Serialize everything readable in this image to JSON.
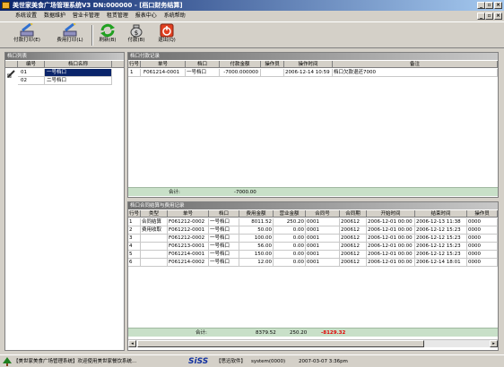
{
  "window": {
    "title": "美世家美食广场管理系统V3 DN:000000 - [档口财务结算]"
  },
  "menu": [
    "系统设置",
    "数据维护",
    "营业卡管理",
    "租赁管理",
    "报表中心",
    "系统帮助"
  ],
  "toolbar": [
    {
      "label": "付款打印(E)",
      "icon": "pen-print-icon"
    },
    {
      "label": "费用打印(L)",
      "icon": "pen-print-icon"
    },
    {
      "label": "刷新(B)",
      "icon": "refresh-icon"
    },
    {
      "label": "付款(B)",
      "icon": "money-bag-icon"
    },
    {
      "label": "退出(Q)",
      "icon": "exit-icon"
    }
  ],
  "stall_panel": {
    "title": "档口列表",
    "headers": [
      "编号",
      "档口名称"
    ],
    "rows": [
      [
        "01",
        "一号档口"
      ],
      [
        "02",
        "二号档口"
      ]
    ]
  },
  "payment_panel": {
    "title": "档口付款记录",
    "headers": [
      "行号",
      "单号",
      "档口",
      "付款金额",
      "操作员",
      "操作时间",
      "备注"
    ],
    "rows": [
      [
        "1",
        "F061214-0001",
        "一号档口",
        "-7000.000000",
        "",
        "2006-12-14  10:59",
        "档口欠款退还7000"
      ]
    ],
    "total_label": "合计:",
    "total_amount": "-7000.00"
  },
  "contract_panel": {
    "title": "档口合同结算与费用记录",
    "headers": [
      "行号",
      "类型",
      "单号",
      "档口",
      "费用金额",
      "营业金额",
      "合同号",
      "合同期",
      "开始时间",
      "结束时间",
      "操作员"
    ],
    "rows": [
      [
        "1",
        "合同结算",
        "F061212-0002",
        "一号档口",
        "8011.52",
        "250.20",
        "0001",
        "200612",
        "2006-12-01  00:00",
        "2006-12-13  11:38",
        "0000"
      ],
      [
        "2",
        "费用收取",
        "F061212-0001",
        "一号档口",
        "50.00",
        "0.00",
        "0001",
        "200612",
        "2006-12-01  00:00",
        "2006-12-12  15:23",
        "0000"
      ],
      [
        "3",
        "",
        "F061212-0002",
        "一号档口",
        "100.00",
        "0.00",
        "0001",
        "200612",
        "2006-12-01  00:00",
        "2006-12-12  15:23",
        "0000"
      ],
      [
        "4",
        "",
        "F061213-0001",
        "一号档口",
        "56.00",
        "0.00",
        "0001",
        "200612",
        "2006-12-01  00:00",
        "2006-12-12  15:23",
        "0000"
      ],
      [
        "5",
        "",
        "F061214-0001",
        "一号档口",
        "150.00",
        "0.00",
        "0001",
        "200612",
        "2006-12-01  00:00",
        "2006-12-12  15:23",
        "0000"
      ],
      [
        "6",
        "",
        "F061214-0002",
        "一号档口",
        "12.00",
        "0.00",
        "0001",
        "200612",
        "2006-12-01  00:00",
        "2006-12-14  18:01",
        "0000"
      ]
    ],
    "total_label": "合计:",
    "total_fee": "8379.52",
    "total_business": "250.20",
    "total_diff": "-8129.32"
  },
  "status": {
    "app": "【美世家美食广场管理系统】欢迎使用美世家餐饮系统...",
    "brand": "SiSS",
    "company": "【思迅软件】",
    "user": "system(0000)",
    "datetime": "2007-03-07  3:36pm"
  },
  "colors": {
    "selection": "#0a246a",
    "footer": "#c8e0c8",
    "negative": "#e00000"
  }
}
